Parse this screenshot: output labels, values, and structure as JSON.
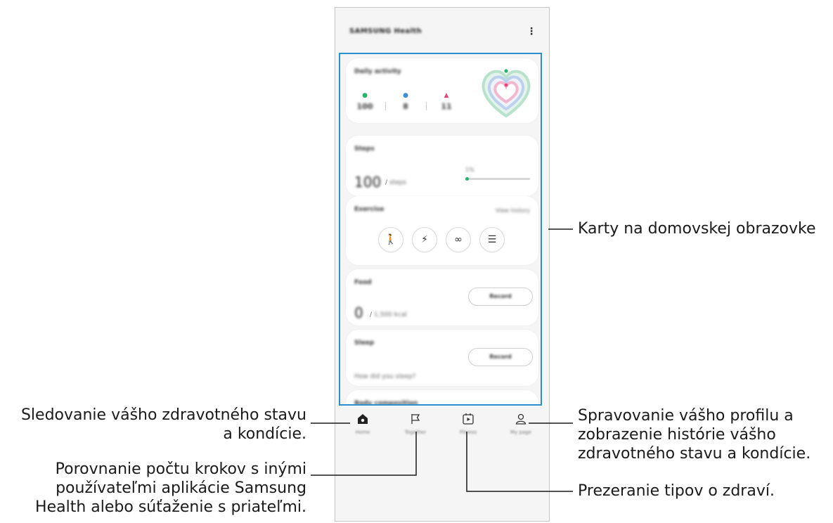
{
  "app": {
    "title": "SAMSUNG Health",
    "menu_icon": "more-vert-icon"
  },
  "cards": {
    "daily_activity": {
      "title": "Daily activity",
      "metrics": [
        {
          "icon": "steps-icon",
          "value": "100",
          "color": "#27b36b"
        },
        {
          "icon": "active-time-icon",
          "value": "8",
          "color": "#3a8fd8"
        },
        {
          "icon": "calories-icon",
          "value": "11",
          "color": "#e0467c"
        }
      ]
    },
    "steps": {
      "title": "Steps",
      "value": "100",
      "unit": "steps",
      "progress_label": "1%",
      "progress_fraction": 0.01
    },
    "exercise": {
      "title": "Exercise",
      "link": "View history",
      "buttons": [
        "walking-icon",
        "running-icon",
        "cycling-icon",
        "list-icon"
      ]
    },
    "food": {
      "title": "Food",
      "value": "0",
      "goal": "1,500 kcal",
      "button": "Record"
    },
    "sleep": {
      "title": "Sleep",
      "question": "How did you sleep?",
      "button": "Record"
    },
    "body_composition": {
      "title": "Body composition"
    }
  },
  "bottom_nav": [
    {
      "label": "Home",
      "icon": "home-icon"
    },
    {
      "label": "Together",
      "icon": "flag-icon"
    },
    {
      "label": "Fitness",
      "icon": "play-calendar-icon"
    },
    {
      "label": "My page",
      "icon": "person-icon"
    }
  ],
  "callouts": {
    "cards": "Karty na domovskej obrazovke",
    "home_line1": "Sledovanie vášho zdravotného stavu",
    "home_line2": "a kondície.",
    "together_line1": "Porovnanie počtu krokov s inými",
    "together_line2": "používateľmi aplikácie Samsung",
    "together_line3": "Health alebo súťaženie s priateľmi.",
    "profile_line1": "Spravovanie vášho profilu a",
    "profile_line2": "zobrazenie histórie vášho",
    "profile_line3": "zdravotného stavu a kondície.",
    "fitness": "Prezeranie tipov o zdraví."
  },
  "colors": {
    "accent_line": "#2b8fd0",
    "callout_line": "#1a1a1a"
  }
}
